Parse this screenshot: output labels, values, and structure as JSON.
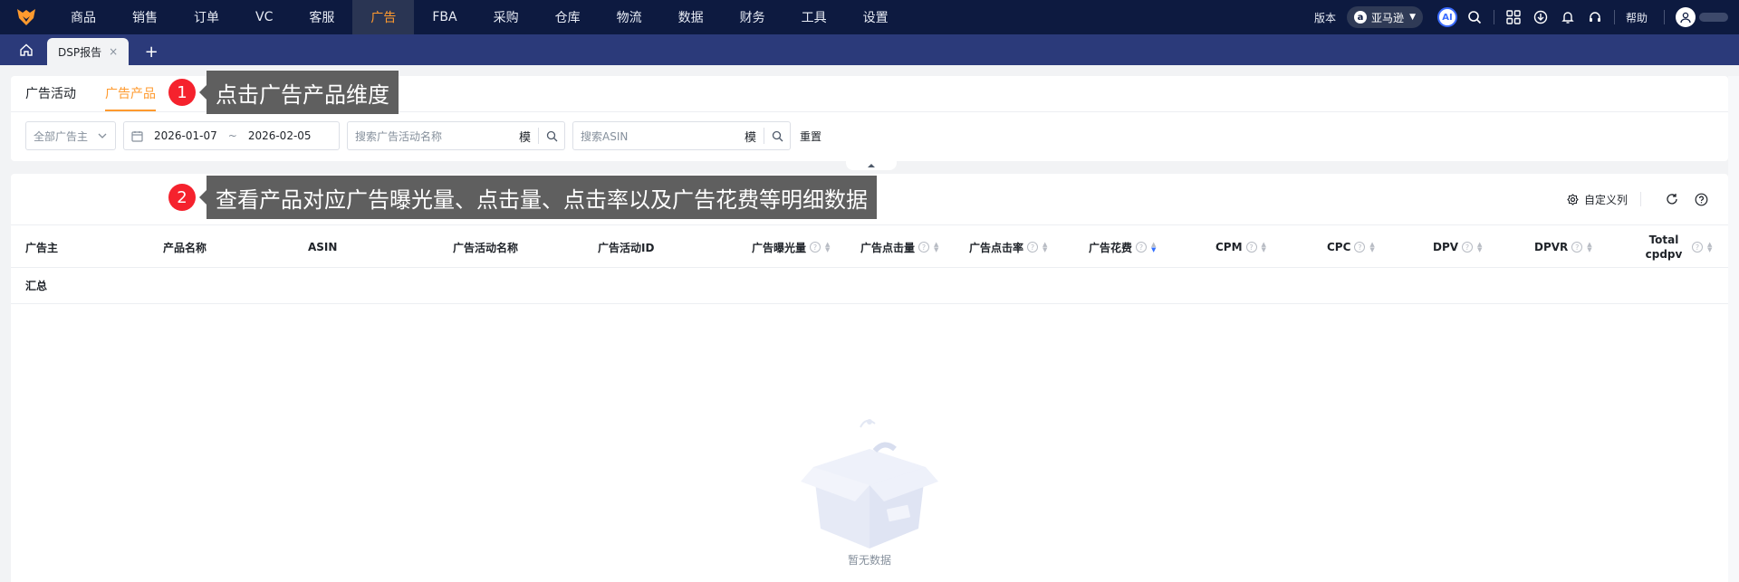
{
  "topnav": {
    "items": [
      "商品",
      "销售",
      "订单",
      "VC",
      "客服",
      "广告",
      "FBA",
      "采购",
      "仓库",
      "物流",
      "数据",
      "财务",
      "工具",
      "设置"
    ],
    "active_index": 5,
    "version_label": "版本",
    "region": "亚马逊",
    "ai_label": "AI",
    "help_label": "帮助"
  },
  "tabs": {
    "current": "DSP报告",
    "close": "×",
    "add": "+"
  },
  "subtabs": [
    "广告活动",
    "广告产品"
  ],
  "filters": {
    "advertiser_placeholder": "全部广告主",
    "date_start": "2026-01-07",
    "date_sep": "~",
    "date_end": "2026-02-05",
    "campaign_placeholder": "搜索广告活动名称",
    "asin_placeholder": "搜索ASIN",
    "fuzzy_label": "模",
    "reset_label": "重置"
  },
  "toolbar": {
    "custom_columns_label": "自定义列"
  },
  "table": {
    "columns": [
      "广告主",
      "产品名称",
      "ASIN",
      "广告活动名称",
      "广告活动ID",
      "广告曝光量",
      "广告点击量",
      "广告点击率",
      "广告花费",
      "CPM",
      "CPC",
      "DPV",
      "DPVR",
      "Total cpdpv"
    ],
    "summary_label": "汇总",
    "empty_text": "暂无数据"
  },
  "callouts": [
    {
      "number": "1",
      "text": "点击广告产品维度"
    },
    {
      "number": "2",
      "text": "查看产品对应广告曝光量、点击量、点击率以及广告花费等明细数据"
    }
  ],
  "colors": {
    "nav_bg": "#0d1a40",
    "tabstrip_bg": "#2b3a7a",
    "accent_orange": "#ff9a2e",
    "callout_red": "#f5222d",
    "callout_bg": "#5f5f5f"
  }
}
